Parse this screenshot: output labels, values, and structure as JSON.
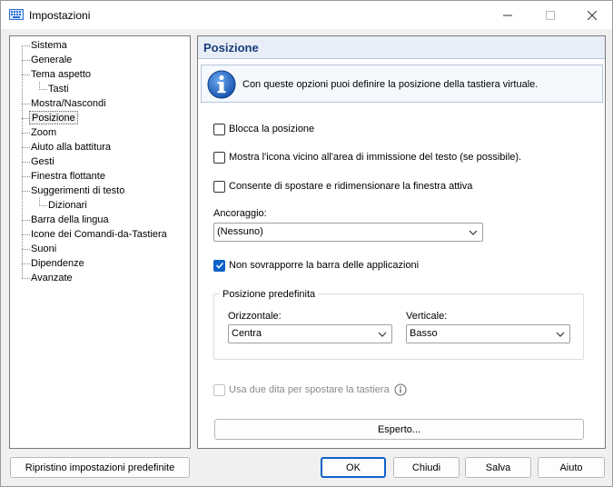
{
  "window": {
    "title": "Impostazioni"
  },
  "tree": {
    "items": [
      {
        "label": "Sistema",
        "level": 0
      },
      {
        "label": "Generale",
        "level": 0
      },
      {
        "label": "Tema aspetto",
        "level": 0
      },
      {
        "label": "Tasti",
        "level": 1
      },
      {
        "label": "Mostra/Nascondi",
        "level": 0
      },
      {
        "label": "Posizione",
        "level": 0,
        "selected": true
      },
      {
        "label": "Zoom",
        "level": 0
      },
      {
        "label": "Aiuto alla battitura",
        "level": 0
      },
      {
        "label": "Gesti",
        "level": 0
      },
      {
        "label": "Finestra flottante",
        "level": 0
      },
      {
        "label": "Suggerimenti di testo",
        "level": 0
      },
      {
        "label": "Dizionari",
        "level": 1
      },
      {
        "label": "Barra della lingua",
        "level": 0
      },
      {
        "label": "Icone dei Comandi-da-Tastiera",
        "level": 0
      },
      {
        "label": "Suoni",
        "level": 0
      },
      {
        "label": "Dipendenze",
        "level": 0
      },
      {
        "label": "Avanzate",
        "level": 0
      }
    ]
  },
  "panel": {
    "title": "Posizione",
    "info": "Con queste opzioni puoi definire la posizione della tastiera virtuale.",
    "options": {
      "lock": "Blocca la posizione",
      "show_icon": "Mostra l'icona vicino all'area di immissione del testo (se possibile).",
      "move_resize": "Consente di spostare e ridimensionare la finestra attiva",
      "no_overlap": "Non sovrapporre la barra delle applicazioni",
      "two_fingers": "Usa due dita per spostare la tastiera"
    },
    "anchor": {
      "label": "Ancoraggio:",
      "value": "(Nessuno)"
    },
    "default_pos": {
      "title": "Posizione predefinita",
      "horizontal_label": "Orizzontale:",
      "horizontal_value": "Centra",
      "vertical_label": "Verticale:",
      "vertical_value": "Basso"
    },
    "expert_button": "Esperto..."
  },
  "footer": {
    "reset": "Ripristino impostazioni predefinite",
    "ok": "OK",
    "close": "Chiudi",
    "save": "Salva",
    "help": "Aiuto"
  },
  "colors": {
    "accent": "#0f62c8",
    "header_bg": "#e8eef7",
    "header_text": "#1a3c78"
  }
}
